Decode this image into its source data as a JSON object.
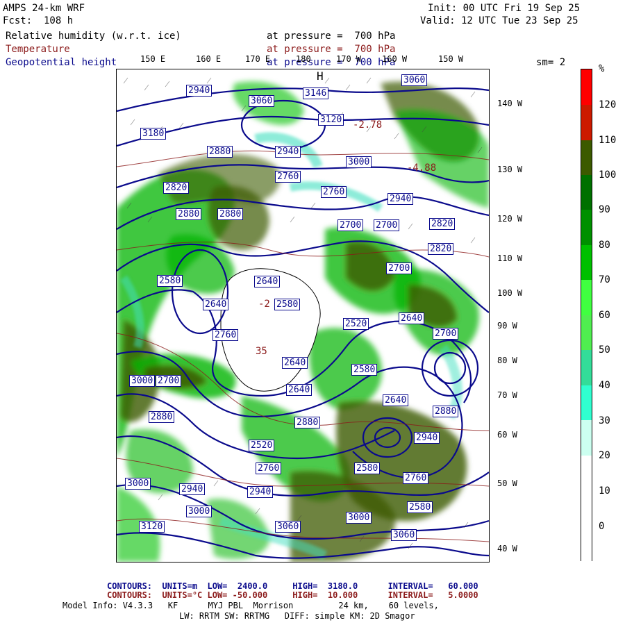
{
  "header": {
    "model": "AMPS 24-km WRF",
    "forecast": "Fcst:  108 h",
    "init": "Init: 00 UTC Fri 19 Sep 25",
    "valid": "Valid: 12 UTC Tue 23 Sep 25",
    "field1_name": "Relative humidity (w.r.t. ice)",
    "field1_level": "at pressure =  700 hPa",
    "field2_name": "Temperature",
    "field2_level": "at pressure =  700 hPa",
    "field3_name": "Geopotential height",
    "field3_level": "at pressure =  700 hPa",
    "smoothing": "sm= 2"
  },
  "map": {
    "longitude_labels": [
      "150 E",
      "160 E",
      "170 E",
      "180",
      "170 W",
      "160 W",
      "150 W"
    ],
    "latitude_labels": [
      "140 W",
      "130 W",
      "120 W",
      "110 W",
      "100 W",
      "90 W",
      "80 W",
      "70 W",
      "60 W",
      "50 W",
      "40 W"
    ],
    "height_contour_labels": [
      "2940",
      "3060",
      "3146",
      "3120",
      "3180",
      "3060",
      "2880",
      "2940",
      "2760",
      "2820",
      "3000",
      "2940",
      "2760",
      "2880",
      "2880",
      "2700",
      "2820",
      "2700",
      "2820",
      "2640",
      "2580",
      "2640",
      "2580",
      "2520",
      "2640",
      "2700",
      "2880",
      "2700",
      "2640",
      "2940",
      "3000",
      "2940",
      "2880",
      "3000",
      "2760",
      "3000",
      "3060",
      "3120",
      "2580",
      "2940",
      "2760",
      "2880",
      "3060",
      "3000",
      "2580",
      "2640",
      "2520",
      "2700",
      "2580",
      "2640",
      "2760"
    ],
    "temperature_labels": [
      "-2.78",
      "-4.88",
      "-2",
      "35"
    ],
    "high_marker": "H",
    "colors": {
      "height_contour": "#0a0a8c",
      "temperature_contour": "#8b1a1a",
      "rh_green": "#00a000",
      "rh_olive": "#3c5a00"
    }
  },
  "colorbar": {
    "unit": "%",
    "labels": [
      "120",
      "110",
      "100",
      "90",
      "80",
      "70",
      "60",
      "50",
      "40",
      "30",
      "20",
      "10",
      "0"
    ],
    "colors": [
      "#ff0000",
      "#cc1a00",
      "#a02000",
      "#3c5a00",
      "#007000",
      "#009000",
      "#00c000",
      "#40ff40",
      "#50ee50",
      "#33dd99",
      "#30ffd0",
      "#ccfff0",
      "#ffffff",
      "#ffffff"
    ]
  },
  "footer": {
    "contours_height": "CONTOURS:  UNITS=m  LOW=  2400.0     HIGH=  3180.0      INTERVAL=   60.000",
    "contours_temp": "CONTOURS:  UNITS=°C LOW= -50.000     HIGH=  10.000      INTERVAL=   5.0000",
    "model_info_1": "Model Info: V4.3.3   KF      MYJ PBL  Morrison         24 km,    60 levels,",
    "model_info_2": "LW: RRTM SW: RRTMG   DIFF: simple KM: 2D Smagor"
  }
}
